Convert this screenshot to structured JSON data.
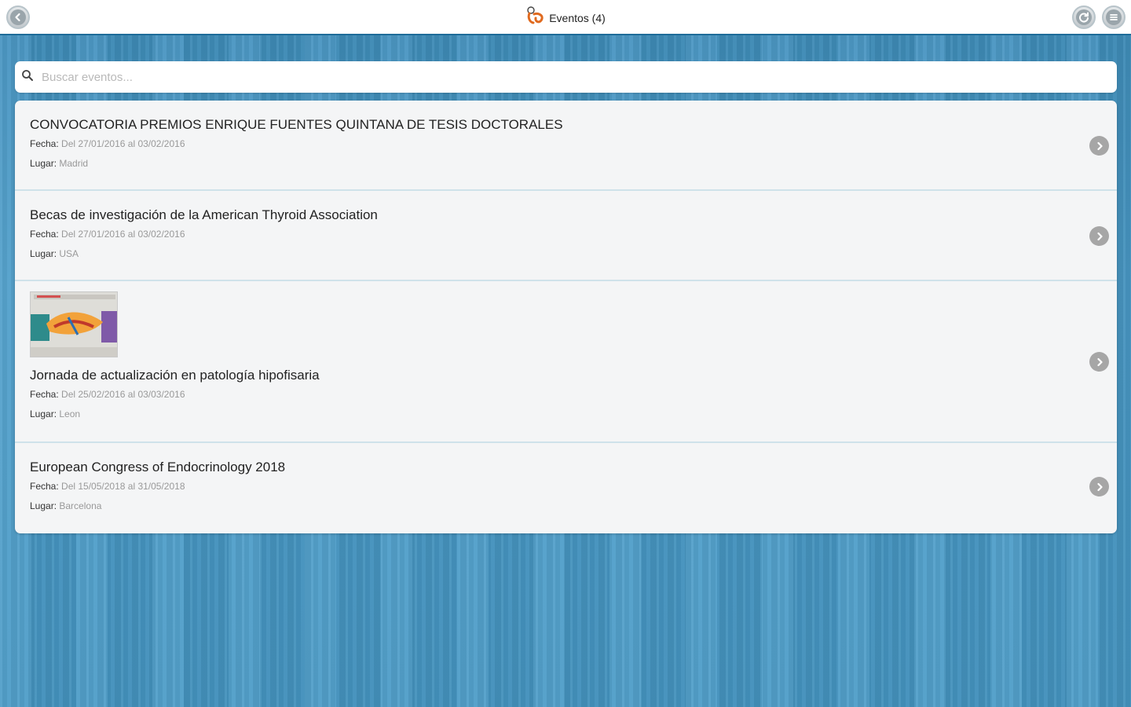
{
  "header": {
    "title": "Eventos (4)",
    "icons": {
      "back": "back-arrow-icon",
      "logo": "app-logo-icon",
      "refresh": "refresh-icon",
      "menu": "menu-icon"
    }
  },
  "search": {
    "placeholder": "Buscar eventos...",
    "value": "",
    "icon": "search-icon"
  },
  "labels": {
    "fecha": "Fecha:",
    "lugar": "Lugar:"
  },
  "events": [
    {
      "title": "CONVOCATORIA PREMIOS ENRIQUE FUENTES QUINTANA DE TESIS DOCTORALES",
      "fecha": "Del 27/01/2016 al 03/02/2016",
      "lugar": "Madrid"
    },
    {
      "title": "Becas de investigación de la American Thyroid Association",
      "fecha": "Del 27/01/2016 al 03/02/2016",
      "lugar": "USA"
    },
    {
      "title": "Jornada de actualización en patología hipofisaria",
      "fecha": "Del 25/02/2016 al 03/03/2016",
      "lugar": "Leon"
    },
    {
      "title": "European Congress of Endocrinology 2018",
      "fecha": "Del 15/05/2018 al 31/05/2018",
      "lugar": "Barcelona"
    }
  ],
  "colors": {
    "header_border": "#1e6c99",
    "background": "#4b9cc9",
    "list_bg": "#f4f5f6",
    "divider": "#cfe2ea"
  }
}
